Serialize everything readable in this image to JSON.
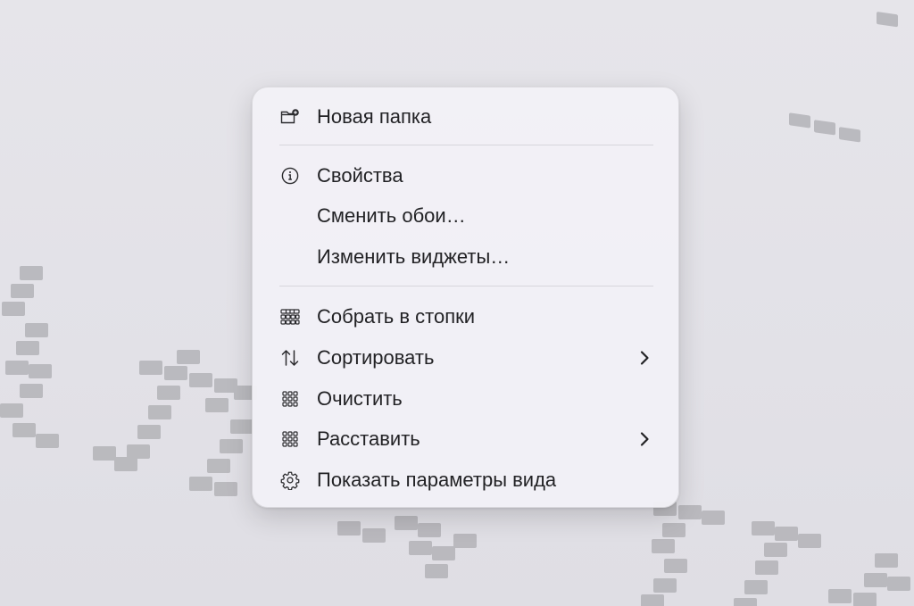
{
  "menu": {
    "items": [
      {
        "label": "Новая папка",
        "icon": "new-folder-icon"
      },
      {
        "label": "Свойства",
        "icon": "info-icon"
      },
      {
        "label": "Сменить обои…",
        "icon": ""
      },
      {
        "label": "Изменить виджеты…",
        "icon": ""
      },
      {
        "label": "Собрать в стопки",
        "icon": "stacks-icon"
      },
      {
        "label": "Сортировать",
        "icon": "sort-arrows-icon",
        "submenu": true
      },
      {
        "label": "Очистить",
        "icon": "grid-icon"
      },
      {
        "label": "Расставить",
        "icon": "grid-icon",
        "submenu": true
      },
      {
        "label": "Показать параметры вида",
        "icon": "gear-icon"
      }
    ]
  },
  "colors": {
    "background": "#e3e2e8",
    "menu_background": "#f2f1f6",
    "text": "#222225",
    "separator": "#d7d6dc",
    "pattern": "#b3b3b8"
  }
}
